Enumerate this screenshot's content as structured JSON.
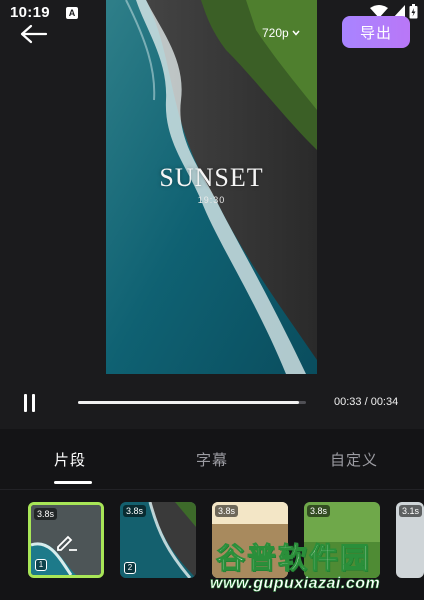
{
  "status": {
    "time": "10:19",
    "a_badge": "A"
  },
  "top_bar": {
    "export_label": "导出"
  },
  "video": {
    "resolution": "720p",
    "title": "SUNSET",
    "subtitle": "19:30"
  },
  "playback": {
    "time": "00:33 / 00:34",
    "progress": 0.97
  },
  "tabs": [
    {
      "label": "片段",
      "active": true
    },
    {
      "label": "字幕",
      "active": false
    },
    {
      "label": "自定义",
      "active": false
    }
  ],
  "clips": [
    {
      "duration": "3.8s",
      "index": "1",
      "selected": true
    },
    {
      "duration": "3.8s",
      "index": "2",
      "selected": false
    },
    {
      "duration": "3.8s",
      "index": "",
      "selected": false
    },
    {
      "duration": "3.8s",
      "index": "",
      "selected": false
    },
    {
      "duration": "3.1s",
      "index": "",
      "selected": false
    }
  ],
  "watermark": {
    "main": "谷普软件园",
    "url": "www.gupuxiazai.com"
  },
  "colors": {
    "accent": "#b47cf8",
    "selected_border": "#a8e657",
    "background": "#1b1b1d"
  }
}
